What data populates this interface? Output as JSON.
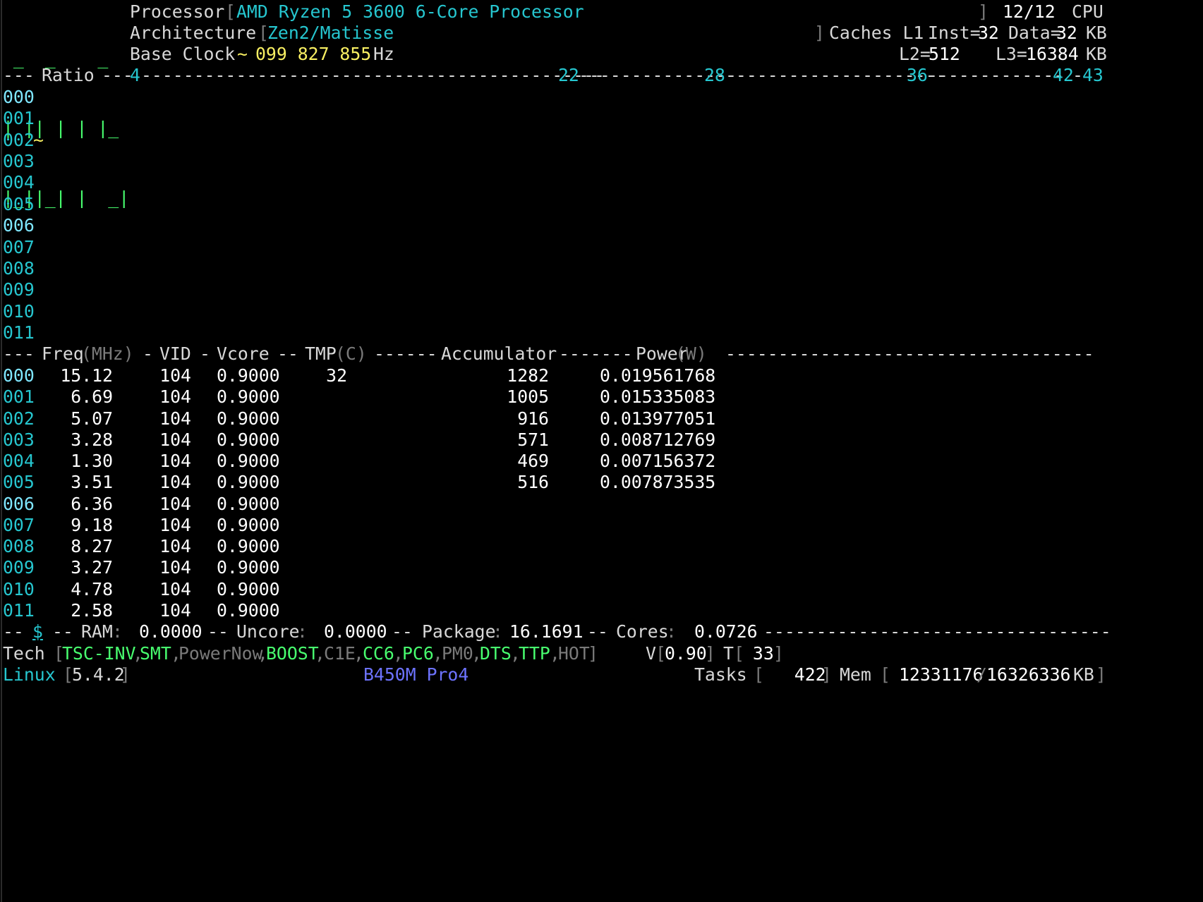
{
  "header": {
    "logo": [
      " _  _    _",
      "| || | | |_",
      "|_||_| |  _|"
    ],
    "processor_label": "Processor",
    "processor_value": "AMD Ryzen 5 3600 6-Core Processor",
    "cpu_count": "12/12",
    "cpu_label": "CPU",
    "architecture_label": "Architecture",
    "architecture_value": "Zen2/Matisse",
    "caches_label": "Caches L1",
    "inst_label": "Inst=",
    "inst_value": "32",
    "data_label": "Data=",
    "data_value": "32",
    "kb": "KB",
    "base_clock_label": "Base Clock",
    "base_clock_tilde": "~",
    "base_clock_value": "099 827 855",
    "hz": "Hz",
    "l2_label": "L2=",
    "l2_value": "512",
    "l3_label": "L3=",
    "l3_value": "16384"
  },
  "ratio": {
    "title": "Ratio",
    "markers": [
      "4",
      "22",
      "28",
      "36",
      "42",
      "43"
    ]
  },
  "cores": [
    "000",
    "001",
    "002",
    "003",
    "004",
    "005",
    "006",
    "007",
    "008",
    "009",
    "010",
    "011"
  ],
  "core_marker": "~",
  "table": {
    "headers": {
      "freq": "Freq",
      "mhz": "(MHz)",
      "vid": "VID",
      "vcore": "Vcore",
      "tmp": "TMP",
      "c": "(C)",
      "accumulator": "Accumulator",
      "power": "Power",
      "w": "(W)"
    },
    "rows": [
      {
        "core": "000",
        "freq": "15.12",
        "vid": "104",
        "vcore": "0.9000",
        "tmp": "32",
        "acc": "1282",
        "power": "0.019561768"
      },
      {
        "core": "001",
        "freq": "6.69",
        "vid": "104",
        "vcore": "0.9000",
        "tmp": "",
        "acc": "1005",
        "power": "0.015335083"
      },
      {
        "core": "002",
        "freq": "5.07",
        "vid": "104",
        "vcore": "0.9000",
        "tmp": "",
        "acc": "916",
        "power": "0.013977051"
      },
      {
        "core": "003",
        "freq": "3.28",
        "vid": "104",
        "vcore": "0.9000",
        "tmp": "",
        "acc": "571",
        "power": "0.008712769"
      },
      {
        "core": "004",
        "freq": "1.30",
        "vid": "104",
        "vcore": "0.9000",
        "tmp": "",
        "acc": "469",
        "power": "0.007156372"
      },
      {
        "core": "005",
        "freq": "3.51",
        "vid": "104",
        "vcore": "0.9000",
        "tmp": "",
        "acc": "516",
        "power": "0.007873535"
      },
      {
        "core": "006",
        "freq": "6.36",
        "vid": "104",
        "vcore": "0.9000",
        "tmp": "",
        "acc": "",
        "power": ""
      },
      {
        "core": "007",
        "freq": "9.18",
        "vid": "104",
        "vcore": "0.9000",
        "tmp": "",
        "acc": "",
        "power": ""
      },
      {
        "core": "008",
        "freq": "8.27",
        "vid": "104",
        "vcore": "0.9000",
        "tmp": "",
        "acc": "",
        "power": ""
      },
      {
        "core": "009",
        "freq": "3.27",
        "vid": "104",
        "vcore": "0.9000",
        "tmp": "",
        "acc": "",
        "power": ""
      },
      {
        "core": "010",
        "freq": "4.78",
        "vid": "104",
        "vcore": "0.9000",
        "tmp": "",
        "acc": "",
        "power": ""
      },
      {
        "core": "011",
        "freq": "2.58",
        "vid": "104",
        "vcore": "0.9000",
        "tmp": "",
        "acc": "",
        "power": ""
      }
    ]
  },
  "summary": {
    "dollar": "$",
    "ram_label": "RAM",
    "ram_value": "0.0000",
    "uncore_label": "Uncore",
    "uncore_value": "0.0000",
    "package_label": "Package",
    "package_value": "16.1691",
    "cores_label": "Cores",
    "cores_value": "0.0726"
  },
  "tech": {
    "label": "Tech",
    "flags": [
      {
        "name": "TSC-INV",
        "active": true
      },
      {
        "name": "SMT",
        "active": true
      },
      {
        "name": "PowerNow",
        "active": false
      },
      {
        "name": "BOOST",
        "active": true
      },
      {
        "name": "C1E",
        "active": false
      },
      {
        "name": "CC6",
        "active": true
      },
      {
        "name": "PC6",
        "active": true
      },
      {
        "name": "PM0",
        "active": false
      },
      {
        "name": "DTS",
        "active": true
      },
      {
        "name": "TTP",
        "active": true
      },
      {
        "name": "HOT",
        "active": false
      }
    ],
    "v_label": "V",
    "v_value": "0.90",
    "t_label": "T",
    "t_value": " 33"
  },
  "footer": {
    "os_label": "Linux",
    "kernel": "5.4.2",
    "board": "B450M Pro4",
    "tasks_label": "Tasks",
    "tasks_value": "   422",
    "mem_label": "Mem",
    "mem_used": "12331176",
    "mem_total": "16326336",
    "mem_unit": "KB"
  },
  "colors": {
    "background": "#000000",
    "text": "#d8d8d8",
    "cyan": "#26c6cf",
    "bright_cyan": "#7fe7ff",
    "green": "#48ff6f",
    "yellow": "#f8ef62",
    "blue": "#6d73ff",
    "gray": "#7a7a7a"
  }
}
